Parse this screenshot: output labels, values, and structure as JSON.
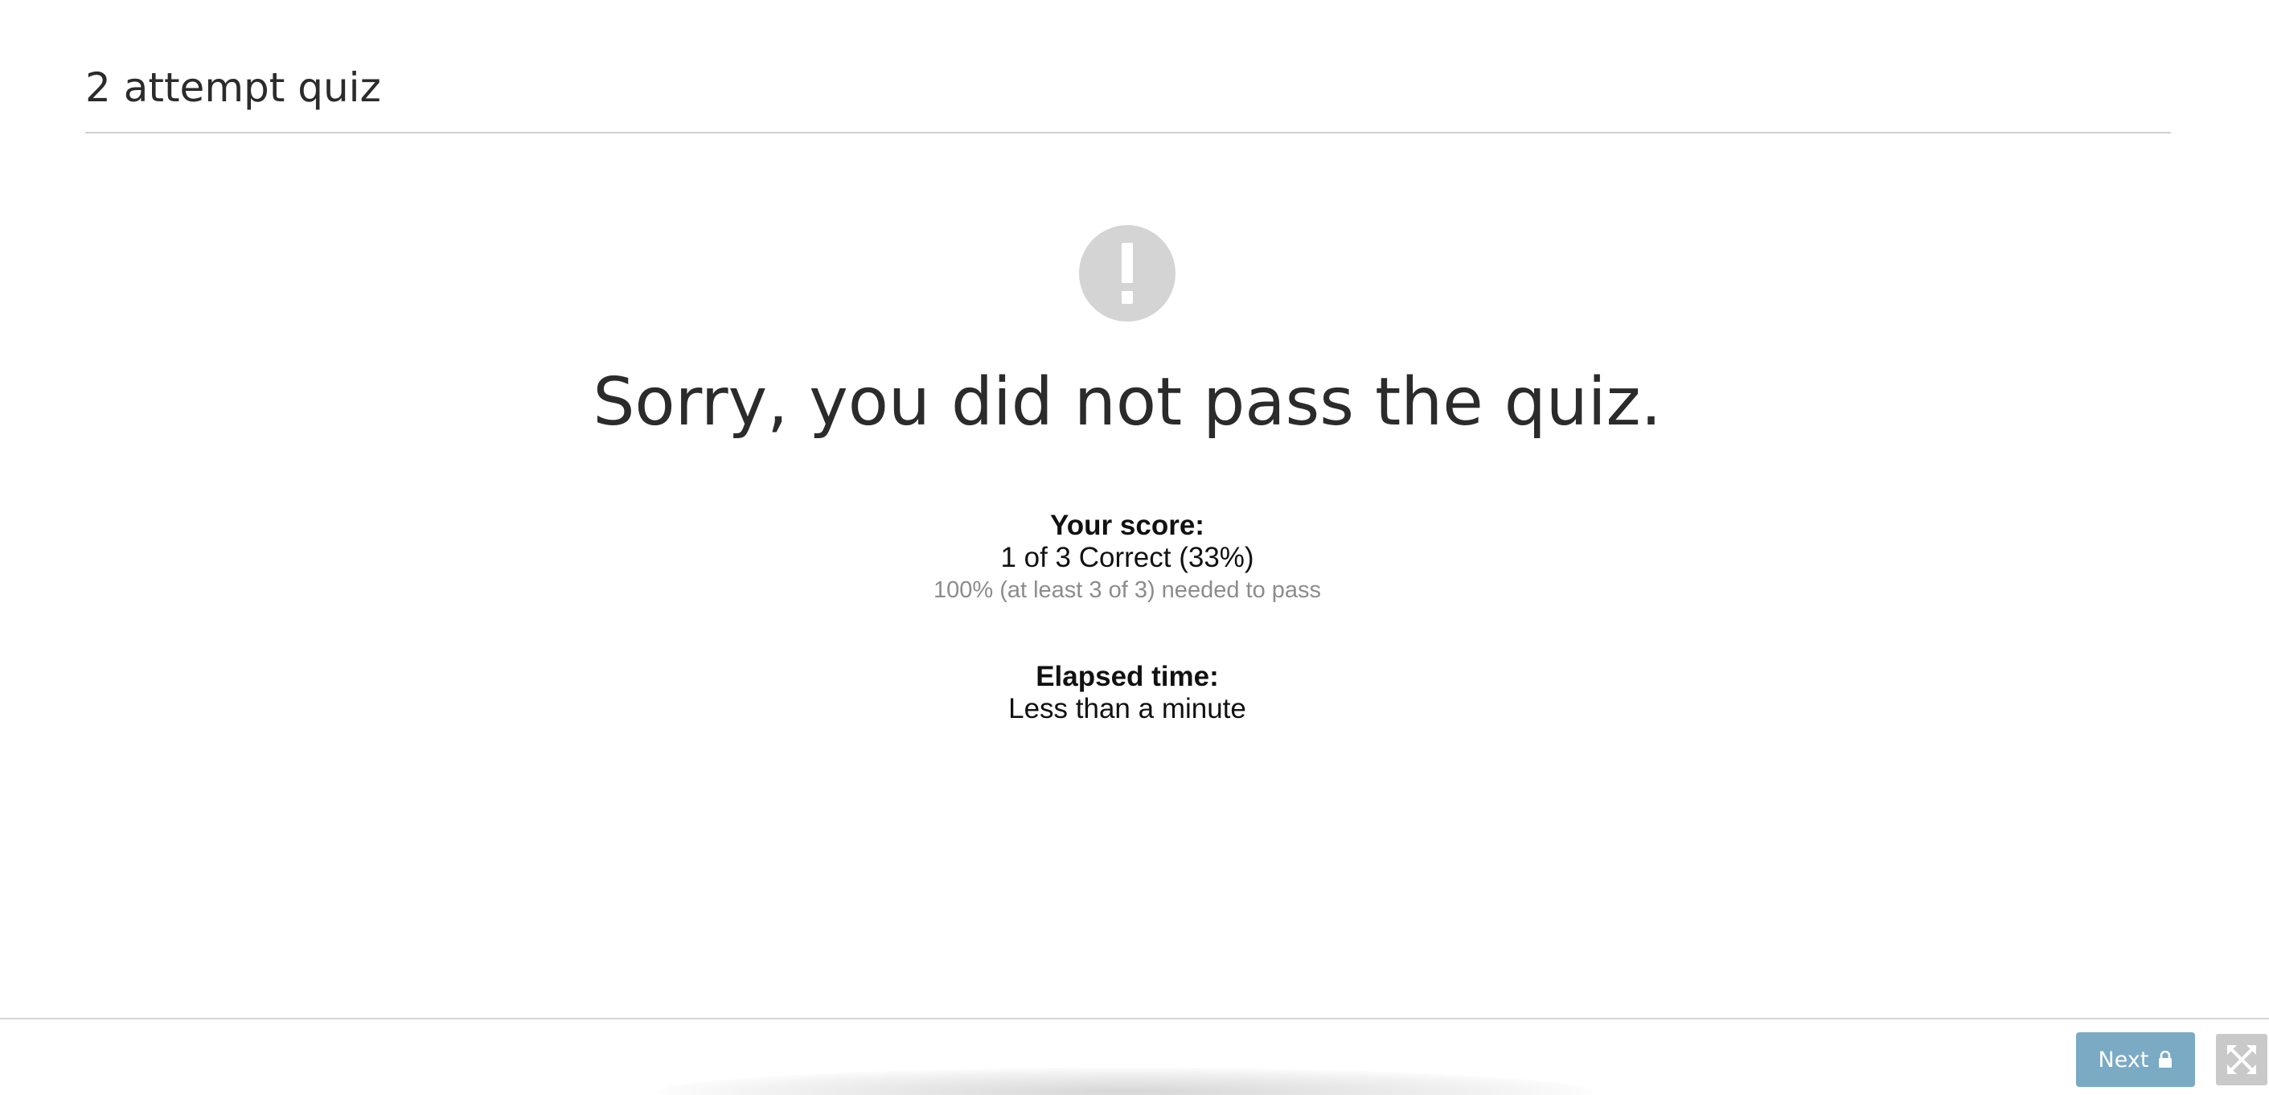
{
  "quiz": {
    "title": "2 attempt quiz"
  },
  "result": {
    "icon": "exclamation-circle-icon",
    "heading": "Sorry, you did not pass the quiz."
  },
  "score": {
    "label": "Your score:",
    "value": "1 of 3 Correct (33%)",
    "requirement": "100% (at least 3 of 3) needed to pass"
  },
  "elapsed": {
    "label": "Elapsed time:",
    "value": "Less than a minute"
  },
  "footer": {
    "next_label": "Next",
    "next_icon": "lock-icon",
    "fullscreen_icon": "fullscreen-expand-icon"
  },
  "colors": {
    "next_button_bg": "#7aaac4",
    "icon_gray": "#d4d4d4",
    "text_dark": "#2b2b2b",
    "text_muted": "#8c8c8c"
  }
}
